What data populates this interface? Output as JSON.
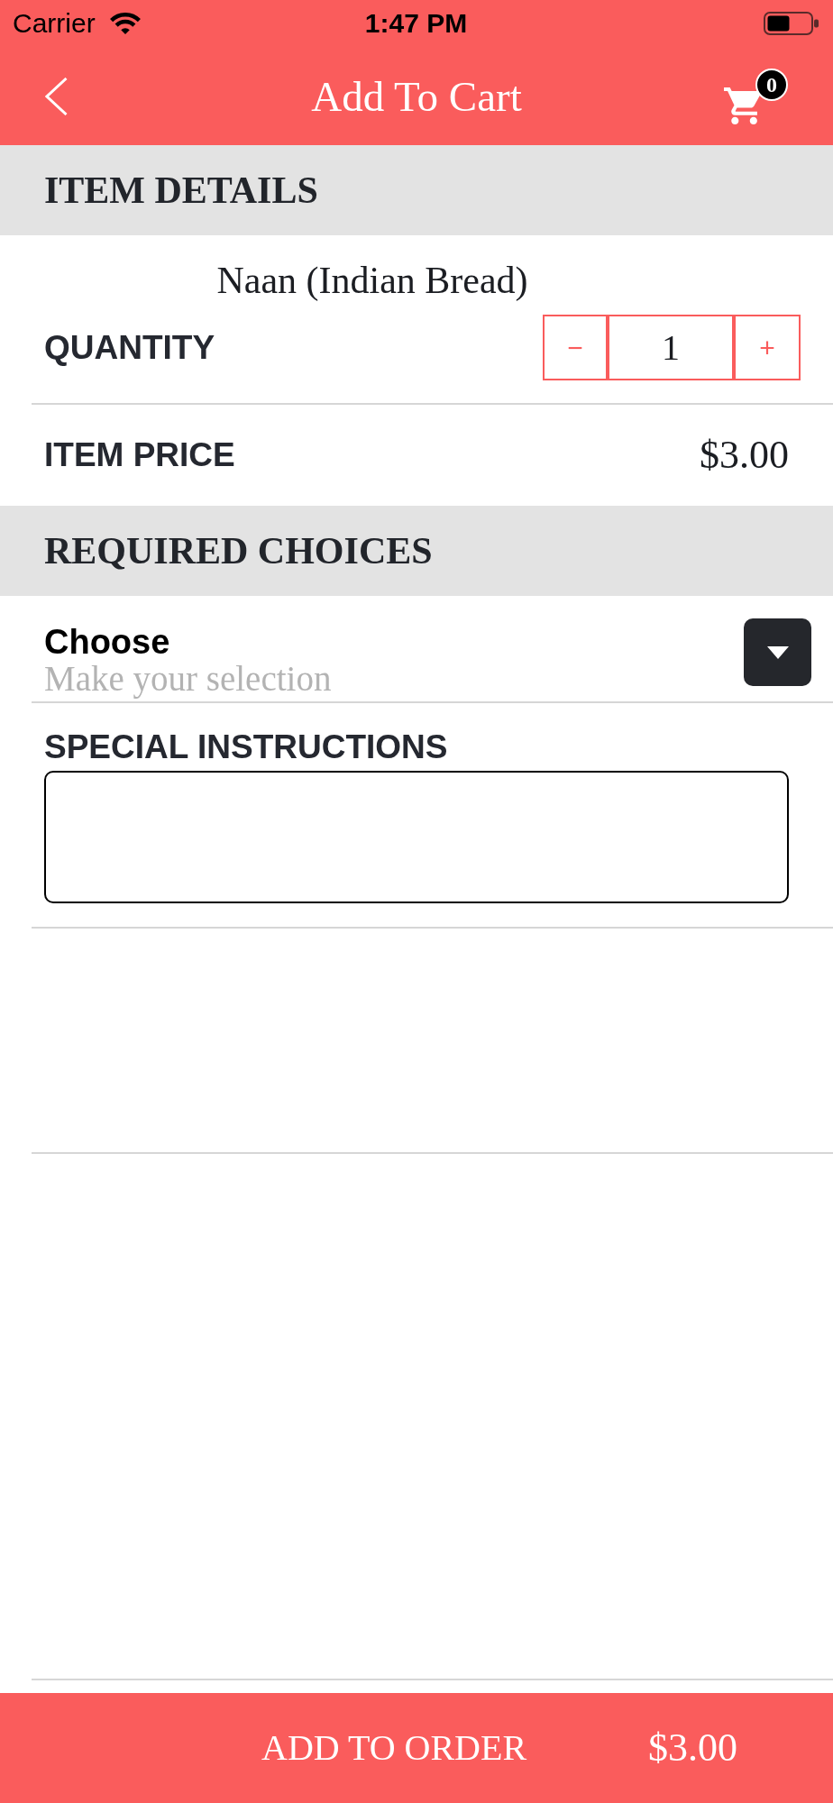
{
  "status_bar": {
    "carrier": "Carrier",
    "time": "1:47 PM"
  },
  "nav_bar": {
    "title": "Add To Cart",
    "cart_count": "0"
  },
  "item_details": {
    "heading": "ITEM DETAILS",
    "item_name": "Naan (Indian Bread)",
    "quantity": {
      "label": "QUANTITY",
      "decrement": "−",
      "value": "1",
      "increment": "+"
    },
    "price": {
      "label": "ITEM PRICE",
      "value": "$3.00"
    }
  },
  "required_choices": {
    "heading": "REQUIRED CHOICES",
    "choices": [
      {
        "label": "Choose",
        "placeholder": "Make your selection"
      }
    ]
  },
  "special_instructions": {
    "label": "SPECIAL INSTRUCTIONS"
  },
  "order_bar": {
    "button": "ADD TO ORDER",
    "total": "$3.00"
  }
}
